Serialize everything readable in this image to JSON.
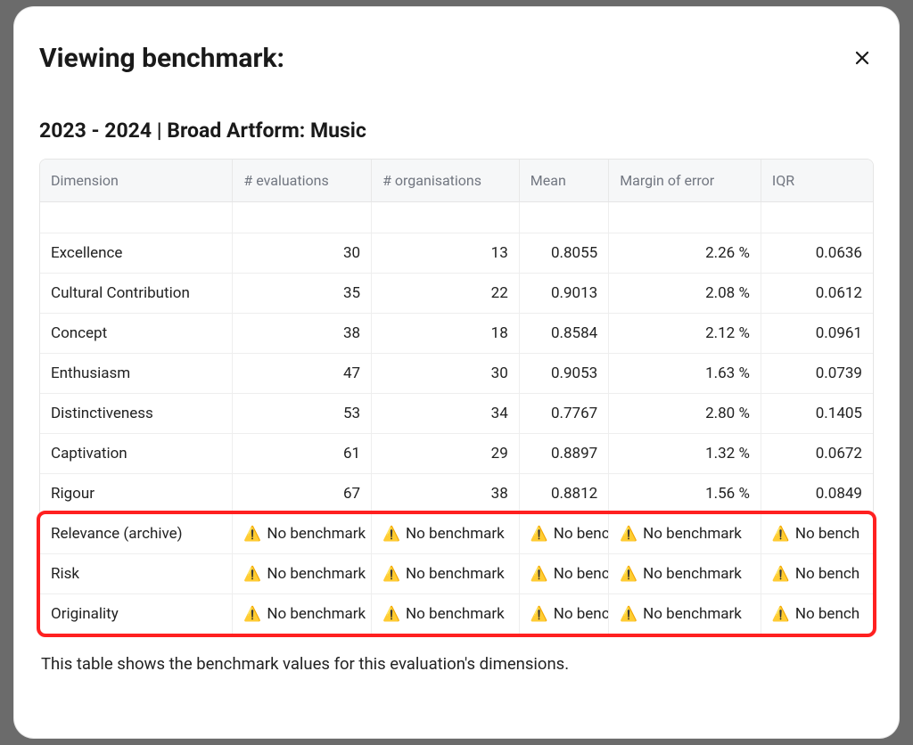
{
  "modal": {
    "title": "Viewing benchmark:",
    "close_label": "Close"
  },
  "subheading": "2023 - 2024 | Broad Artform: Music",
  "columns": {
    "dimension": "Dimension",
    "evaluations": "# evaluations",
    "organisations": "# organisations",
    "mean": "Mean",
    "moe": "Margin of error",
    "iqr": "IQR"
  },
  "no_benchmark_label": "No benchmark",
  "no_benchmark_label_trunc": "No bench",
  "rows": [
    {
      "dimension": "Excellence",
      "evaluations": "30",
      "organisations": "13",
      "mean": "0.8055",
      "moe": "2.26 %",
      "iqr": "0.0636"
    },
    {
      "dimension": "Cultural Contribution",
      "evaluations": "35",
      "organisations": "22",
      "mean": "0.9013",
      "moe": "2.08 %",
      "iqr": "0.0612"
    },
    {
      "dimension": "Concept",
      "evaluations": "38",
      "organisations": "18",
      "mean": "0.8584",
      "moe": "2.12 %",
      "iqr": "0.0961"
    },
    {
      "dimension": "Enthusiasm",
      "evaluations": "47",
      "organisations": "30",
      "mean": "0.9053",
      "moe": "1.63 %",
      "iqr": "0.0739"
    },
    {
      "dimension": "Distinctiveness",
      "evaluations": "53",
      "organisations": "34",
      "mean": "0.7767",
      "moe": "2.80 %",
      "iqr": "0.1405"
    },
    {
      "dimension": "Captivation",
      "evaluations": "61",
      "organisations": "29",
      "mean": "0.8897",
      "moe": "1.32 %",
      "iqr": "0.0672"
    },
    {
      "dimension": "Rigour",
      "evaluations": "67",
      "organisations": "38",
      "mean": "0.8812",
      "moe": "1.56 %",
      "iqr": "0.0849"
    }
  ],
  "warn_rows": [
    {
      "dimension": "Relevance (archive)"
    },
    {
      "dimension": "Risk"
    },
    {
      "dimension": "Originality"
    }
  ],
  "caption": "This table shows the benchmark values for this evaluation's dimensions."
}
